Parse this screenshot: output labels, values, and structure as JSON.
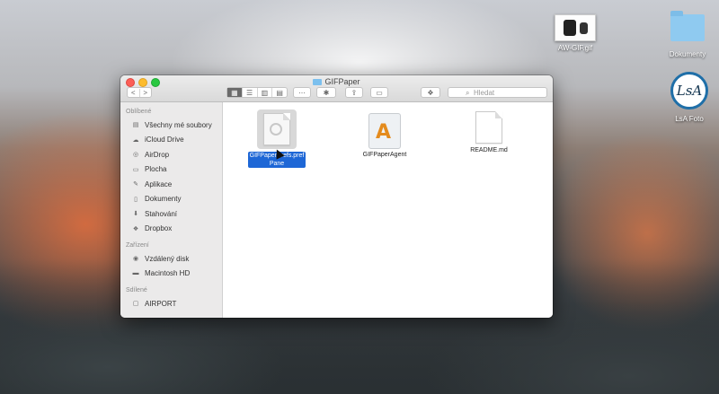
{
  "desktop": {
    "icons": [
      {
        "label": "AW-GIF.gif",
        "icon": "gif-thumbnail-icon"
      },
      {
        "label": "Dokumenty",
        "icon": "folder-icon"
      },
      {
        "label": "LsA Foto",
        "icon": "lsa-logo-icon"
      }
    ],
    "logo_text": "LsA"
  },
  "window": {
    "title": "GIFPaper",
    "search_placeholder": "Hledat",
    "toolbar": {
      "back": "<",
      "forward": ">",
      "views": [
        "▦",
        "☰",
        "▥",
        "▤"
      ],
      "arrange": "⋯",
      "action": "✱",
      "share": "⇪",
      "tag": "▭",
      "dropbox": "❖"
    }
  },
  "sidebar": {
    "sections": [
      {
        "heading": "Oblíbené",
        "items": [
          {
            "label": "Všechny mé soubory",
            "icon": "all-files-icon"
          },
          {
            "label": "iCloud Drive",
            "icon": "icloud-icon"
          },
          {
            "label": "AirDrop",
            "icon": "airdrop-icon"
          },
          {
            "label": "Plocha",
            "icon": "desktop-icon"
          },
          {
            "label": "Aplikace",
            "icon": "applications-icon"
          },
          {
            "label": "Dokumenty",
            "icon": "documents-icon"
          },
          {
            "label": "Stahování",
            "icon": "downloads-icon"
          },
          {
            "label": "Dropbox",
            "icon": "dropbox-icon"
          }
        ]
      },
      {
        "heading": "Zařízení",
        "items": [
          {
            "label": "Vzdálený disk",
            "icon": "remote-disc-icon"
          },
          {
            "label": "Macintosh HD",
            "icon": "hard-drive-icon"
          }
        ]
      },
      {
        "heading": "Sdílené",
        "items": [
          {
            "label": "AIRPORT",
            "icon": "airport-icon"
          }
        ]
      }
    ]
  },
  "files": [
    {
      "name_line1": "GIFPaperPrefs.pref",
      "name_line2": "Pane",
      "selected": true
    },
    {
      "name": "GIFPaperAgent",
      "selected": false
    },
    {
      "name": "README.md",
      "selected": false
    }
  ]
}
